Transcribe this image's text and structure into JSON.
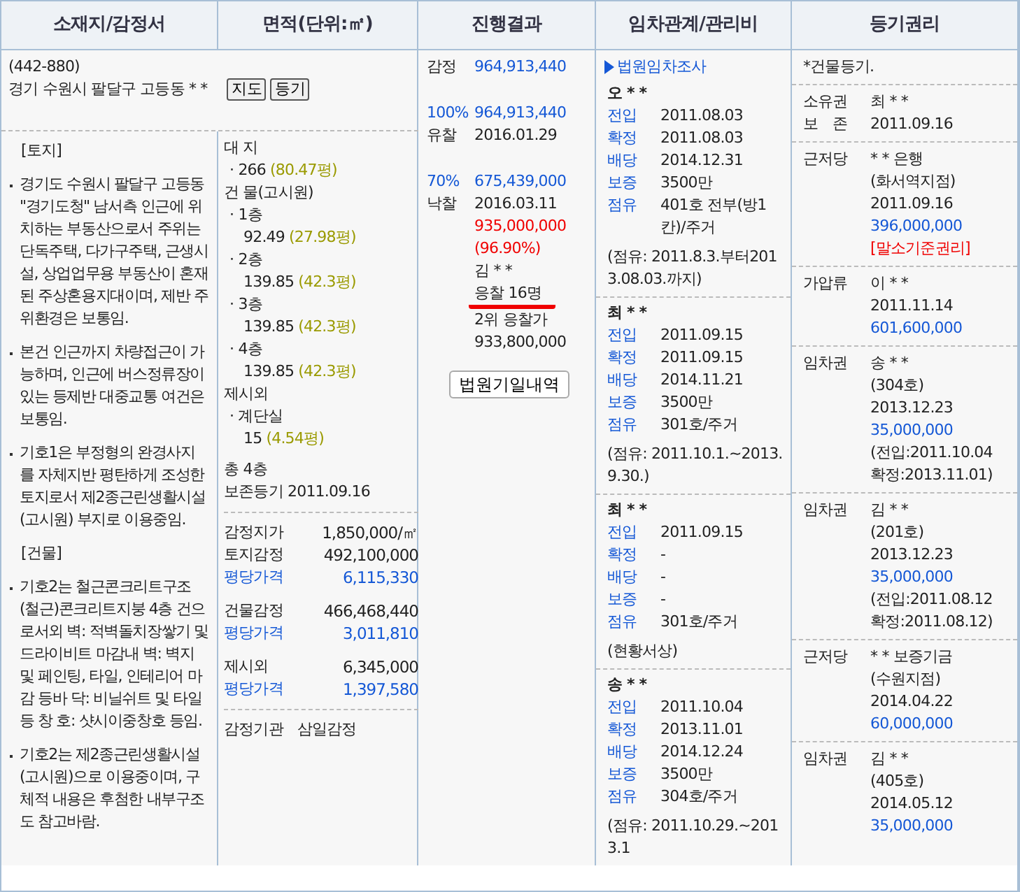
{
  "columns": [
    "소재지/감정서",
    "면적(단위:㎡)",
    "진행결과",
    "임차관계/관리비",
    "등기권리"
  ],
  "address": {
    "postal": "(442-880)",
    "text": "경기 수원시 팔달구 고등동 * *",
    "buttons": [
      "지도",
      "등기"
    ]
  },
  "appraisal": [
    {
      "kind": "heading",
      "text": "[토지]"
    },
    {
      "kind": "bullet",
      "text": "경기도 수원시 팔달구 고등동 \"경기도청\" 남서측 인근에 위치하는 부동산으로서 주위는 단독주택, 다가구주택, 근생시설, 상업업무용 부동산이 혼재된 주상혼용지대이며, 제반 주위환경은 보통임."
    },
    {
      "kind": "bullet",
      "text": "본건 인근까지 차량접근이 가능하며, 인근에 버스정류장이 있는 등제반 대중교통 여건은 보통임."
    },
    {
      "kind": "bullet",
      "text": "기호1은 부정형의 완경사지를 자체지반 평탄하게 조성한 토지로서 제2종근린생활시설(고시원) 부지로 이용중임."
    },
    {
      "kind": "heading",
      "text": "[건물]"
    },
    {
      "kind": "bullet",
      "text": "기호2는 철근콘크리트구조(철근)콘크리트지붕 4층 건으로서외 벽: 적벽돌치장쌓기 및 드라이비트 마감내 벽: 벽지 및 페인팅, 타일, 인테리어 마감 등바 닥: 비닐쉬트 및 타일 등 창 호: 샷시이중창호 등임."
    },
    {
      "kind": "bullet",
      "text": "기호2는 제2종근린생활시설(고시원)으로 이용중이며, 구체적 내용은 후첨한 내부구조도 참고바람."
    }
  ],
  "area": {
    "sections": [
      {
        "title": "대 지",
        "items": [
          {
            "value": "· 266",
            "pyeong": "(80.47평)"
          }
        ]
      },
      {
        "title": "건 물(고시원)",
        "items": [
          {
            "floor": "· 1층",
            "value": "92.49",
            "pyeong": "(27.98평)"
          },
          {
            "floor": "· 2층",
            "value": "139.85",
            "pyeong": "(42.3평)"
          },
          {
            "floor": "· 3층",
            "value": "139.85",
            "pyeong": "(42.3평)"
          },
          {
            "floor": "· 4층",
            "value": "139.85",
            "pyeong": "(42.3평)"
          }
        ]
      },
      {
        "title": "제시외",
        "items": [
          {
            "floor": "· 계단실",
            "value": "15",
            "pyeong": "(4.54평)"
          }
        ]
      }
    ],
    "notes": [
      "총 4층",
      "보존등기 2011.09.16"
    ],
    "valuation": [
      [
        {
          "label": "감정지가",
          "value": "1,850,000/㎡",
          "kind": "price"
        },
        {
          "label": "토지감정",
          "value": "492,100,000",
          "kind": "price"
        },
        {
          "label": "평당가격",
          "value": "6,115,330",
          "kind": "unit"
        }
      ],
      [
        {
          "label": "건물감정",
          "value": "466,468,440",
          "kind": "price"
        },
        {
          "label": "평당가격",
          "value": "3,011,810",
          "kind": "unit"
        }
      ],
      [
        {
          "label": "제시외",
          "value": "6,345,000",
          "kind": "price"
        },
        {
          "label": "평당가격",
          "value": "1,397,580",
          "kind": "unit"
        }
      ]
    ],
    "appraiser": {
      "label": "감정기관",
      "value": "삼일감정"
    }
  },
  "progress": {
    "lines": [
      {
        "kind": "appraisal",
        "label": "감정",
        "value": "964,913,440"
      },
      {
        "kind": "minimum",
        "label": "100%",
        "value": "964,913,440"
      },
      {
        "kind": "fail",
        "label": "유찰",
        "value": "2016.01.29"
      },
      {
        "kind": "minimum",
        "label": "70%",
        "value": "675,439,000"
      },
      {
        "kind": "sold",
        "label": "낙찰",
        "value": "2016.03.11"
      },
      {
        "kind": "price",
        "value": "935,000,000"
      },
      {
        "kind": "price",
        "value": "(96.90%)"
      },
      {
        "kind": "plain",
        "value": "김 * *"
      },
      {
        "kind": "highlight",
        "value": "응찰 16명"
      },
      {
        "kind": "plain",
        "value": "2위 응찰가"
      },
      {
        "kind": "plain",
        "value": "933,800,000"
      }
    ],
    "button": "법원기일내역"
  },
  "tenants": {
    "link": "법원임차조사",
    "items": [
      {
        "name": "오 * *",
        "rows": [
          {
            "label": "전입",
            "value": "2011.08.03"
          },
          {
            "label": "확정",
            "value": "2011.08.03"
          },
          {
            "label": "배당",
            "value": "2014.12.31"
          },
          {
            "label": "보증",
            "value": "3500만"
          },
          {
            "label": "점유",
            "value": "401호 전부(방1칸)/주거"
          }
        ],
        "note": "(점유: 2011.8.3.부터2013.08.03.까지)"
      },
      {
        "name": "최 * *",
        "rows": [
          {
            "label": "전입",
            "value": "2011.09.15"
          },
          {
            "label": "확정",
            "value": "2011.09.15"
          },
          {
            "label": "배당",
            "value": "2014.11.21"
          },
          {
            "label": "보증",
            "value": "3500만"
          },
          {
            "label": "점유",
            "value": "301호/주거"
          }
        ],
        "note": "(점유: 2011.10.1.~2013.9.30.)"
      },
      {
        "name": "최 * *",
        "rows": [
          {
            "label": "전입",
            "value": "2011.09.15"
          },
          {
            "label": "확정",
            "value": "-"
          },
          {
            "label": "배당",
            "value": "-"
          },
          {
            "label": "보증",
            "value": "-"
          },
          {
            "label": "점유",
            "value": "301호/주거"
          }
        ],
        "note": "(현황서상)"
      },
      {
        "name": "송 * *",
        "rows": [
          {
            "label": "전입",
            "value": "2011.10.04"
          },
          {
            "label": "확정",
            "value": "2013.11.01"
          },
          {
            "label": "배당",
            "value": "2014.12.24"
          },
          {
            "label": "보증",
            "value": "3500만"
          },
          {
            "label": "점유",
            "value": "304호/주거"
          }
        ],
        "note": "(점유: 2011.10.29.~2013.1"
      }
    ]
  },
  "rights": {
    "title": "*건물등기.",
    "entries": [
      {
        "rows": [
          {
            "label": "소유권",
            "lines": [
              {
                "kind": "plain",
                "text": "최 * *"
              }
            ]
          },
          {
            "label": "보　존",
            "lines": [
              {
                "kind": "plain",
                "text": "2011.09.16"
              }
            ]
          }
        ]
      },
      {
        "rows": [
          {
            "label": "근저당",
            "lines": [
              {
                "kind": "plain",
                "text": "* * 은행"
              },
              {
                "kind": "plain",
                "text": "(화서역지점)"
              },
              {
                "kind": "plain",
                "text": "2011.09.16"
              },
              {
                "kind": "amount",
                "text": "396,000,000"
              },
              {
                "kind": "warning",
                "text": "[말소기준권리]"
              }
            ]
          }
        ]
      },
      {
        "rows": [
          {
            "label": "가압류",
            "lines": [
              {
                "kind": "plain",
                "text": "이 * *"
              },
              {
                "kind": "plain",
                "text": "2011.11.14"
              },
              {
                "kind": "amount",
                "text": "601,600,000"
              }
            ]
          }
        ]
      },
      {
        "rows": [
          {
            "label": "임차권",
            "lines": [
              {
                "kind": "plain",
                "text": "송 * *"
              },
              {
                "kind": "plain",
                "text": "(304호)"
              },
              {
                "kind": "plain",
                "text": "2013.12.23"
              },
              {
                "kind": "amount",
                "text": "35,000,000"
              },
              {
                "kind": "plain",
                "text": "(전입:2011.10.04"
              },
              {
                "kind": "plain",
                "text": "확정:2013.11.01)"
              }
            ]
          }
        ]
      },
      {
        "rows": [
          {
            "label": "임차권",
            "lines": [
              {
                "kind": "plain",
                "text": "김 * *"
              },
              {
                "kind": "plain",
                "text": "(201호)"
              },
              {
                "kind": "plain",
                "text": "2013.12.23"
              },
              {
                "kind": "amount",
                "text": "35,000,000"
              },
              {
                "kind": "plain",
                "text": "(전입:2011.08.12"
              },
              {
                "kind": "plain",
                "text": "확정:2011.08.12)"
              }
            ]
          }
        ]
      },
      {
        "rows": [
          {
            "label": "근저당",
            "lines": [
              {
                "kind": "plain",
                "text": "* * 보증기금"
              },
              {
                "kind": "plain",
                "text": "(수원지점)"
              },
              {
                "kind": "plain",
                "text": "2014.04.22"
              },
              {
                "kind": "amount",
                "text": "60,000,000"
              }
            ]
          }
        ]
      },
      {
        "rows": [
          {
            "label": "임차권",
            "lines": [
              {
                "kind": "plain",
                "text": "김 * *"
              },
              {
                "kind": "plain",
                "text": "(405호)"
              },
              {
                "kind": "plain",
                "text": "2014.05.12"
              },
              {
                "kind": "amount",
                "text": "35,000,000"
              }
            ]
          }
        ]
      }
    ]
  }
}
